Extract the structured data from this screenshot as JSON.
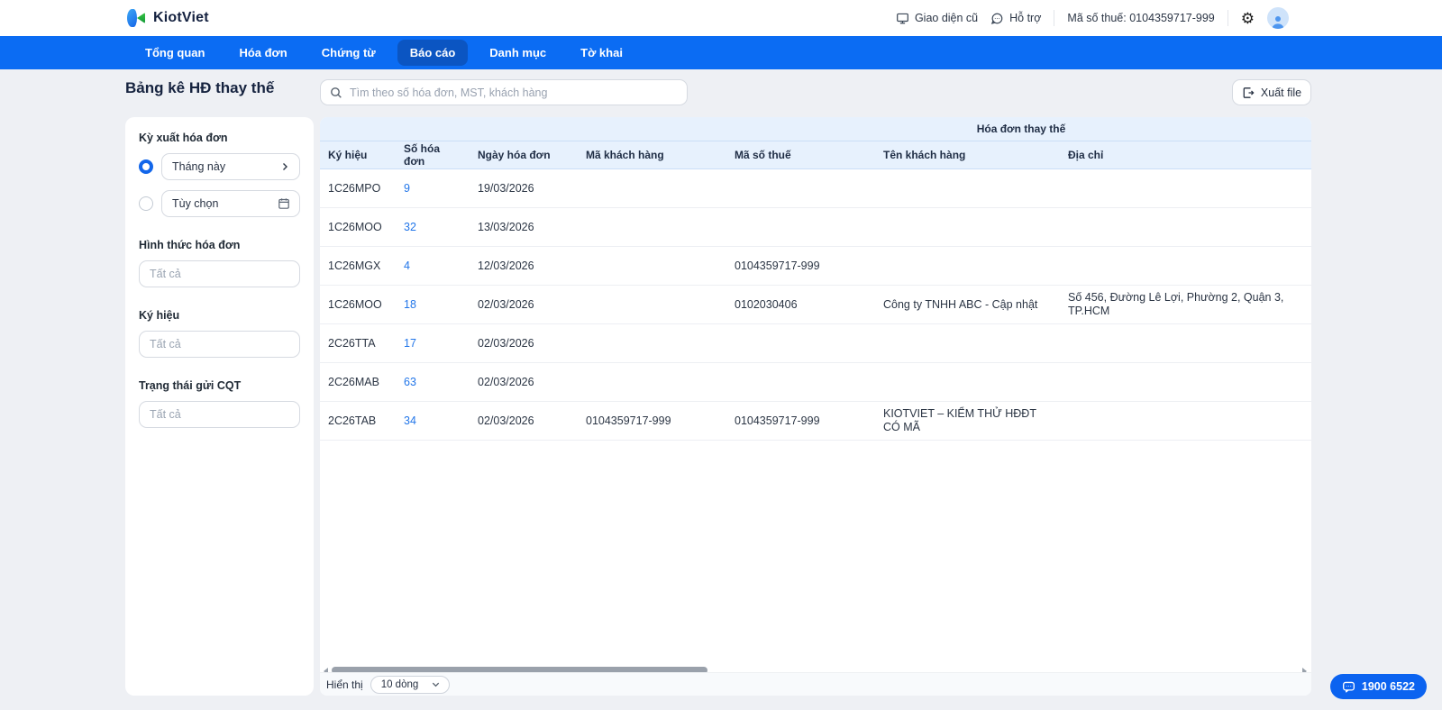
{
  "header": {
    "brand": "KiotViet",
    "old_ui_label": "Giao diện cũ",
    "support_label": "Hỗ trợ",
    "tax_code": "Mã số thuế: 0104359717-999"
  },
  "nav": {
    "items": [
      {
        "label": "Tổng quan"
      },
      {
        "label": "Hóa đơn"
      },
      {
        "label": "Chứng từ"
      },
      {
        "label": "Báo cáo",
        "active": true
      },
      {
        "label": "Danh mục"
      },
      {
        "label": "Tờ khai"
      }
    ]
  },
  "page": {
    "title": "Bảng kê HĐ thay thế"
  },
  "filters": {
    "period_label": "Kỳ xuất hóa đơn",
    "period_this_month": "Tháng này",
    "period_custom": "Tùy chọn",
    "invoice_form_label": "Hình thức hóa đơn",
    "invoice_form_placeholder": "Tất cả",
    "symbol_label": "Ký hiệu",
    "symbol_placeholder": "Tất cả",
    "cqt_status_label": "Trạng thái gửi CQT",
    "cqt_status_placeholder": "Tất cả"
  },
  "toolbar": {
    "search_placeholder": "Tìm theo số hóa đơn, MST, khách hàng",
    "export_label": "Xuất file"
  },
  "table": {
    "group_header": "Hóa đơn thay thế",
    "columns": [
      "Ký hiệu",
      "Số hóa đơn",
      "Ngày hóa đơn",
      "Mã khách hàng",
      "Mã số thuế",
      "Tên khách hàng",
      "Địa chỉ"
    ],
    "rows": [
      [
        "1C26MPO",
        "9",
        "19/03/2026",
        "",
        "",
        "",
        ""
      ],
      [
        "1C26MOO",
        "32",
        "13/03/2026",
        "",
        "",
        "",
        ""
      ],
      [
        "1C26MGX",
        "4",
        "12/03/2026",
        "",
        "0104359717-999",
        "",
        ""
      ],
      [
        "1C26MOO",
        "18",
        "02/03/2026",
        "",
        "0102030406",
        "Công ty TNHH ABC - Cập nhật",
        "Số 456, Đường Lê Lợi, Phường 2, Quận 3, TP.HCM"
      ],
      [
        "2C26TTA",
        "17",
        "02/03/2026",
        "",
        "",
        "",
        ""
      ],
      [
        "2C26MAB",
        "63",
        "02/03/2026",
        "",
        "",
        "",
        ""
      ],
      [
        "2C26TAB",
        "34",
        "02/03/2026",
        "0104359717-999",
        "0104359717-999",
        "KIOTVIET – KIỂM THỬ HĐĐT CÓ MÃ",
        ""
      ]
    ]
  },
  "footer": {
    "display_label": "Hiển thị",
    "page_size": "10 dòng"
  },
  "chat": {
    "phone": "1900 6522"
  },
  "colors": {
    "nav_blue": "#0b6cf3",
    "nav_active_blue": "#0b55c2",
    "link_blue": "#2276e9",
    "table_header_bg": "#e7f1fd",
    "page_bg": "#eef0f4",
    "fab_blue": "#0b63f0"
  }
}
